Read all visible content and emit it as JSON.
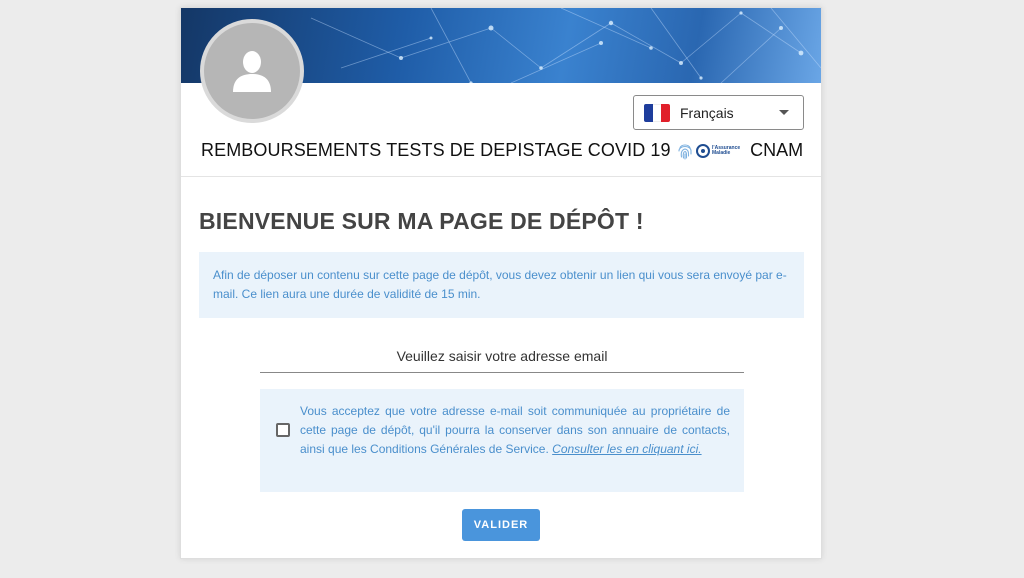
{
  "header": {
    "language": {
      "label": "Français",
      "flag_colors": [
        "#1e3d9c",
        "#ffffff",
        "#e1202b"
      ]
    },
    "app_title": "REMBOURSEMENTS TESTS DE DEPISTAGE COVID 19",
    "org_logo_text": [
      "l'Assurance",
      "Maladie"
    ],
    "org_name": "CNAM"
  },
  "main": {
    "title": "BIENVENUE SUR MA PAGE DE DÉPÔT !",
    "info": "Afin de déposer un contenu sur cette page de dépôt, vous devez obtenir un lien qui vous sera envoyé par e-mail. Ce lien aura une durée de validité de 15 min.",
    "email_placeholder": "Veuillez saisir votre adresse email",
    "consent_text": "Vous acceptez que votre adresse e-mail soit communiquée au propriétaire de cette page de dépôt, qu'il pourra la conserver dans son annuaire de contacts, ainsi que les Conditions Générales de Service.",
    "consent_link": "Consulter les en cliquant ici.",
    "submit_label": "VALIDER"
  },
  "colors": {
    "accent": "#4a95dc",
    "info_text": "#4a8fcc",
    "info_bg": "#eaf3fb"
  },
  "icons": [
    "avatar-placeholder-icon",
    "france-flag-icon",
    "chevron-down-icon",
    "fingerprint-icon",
    "assurance-maladie-logo"
  ]
}
